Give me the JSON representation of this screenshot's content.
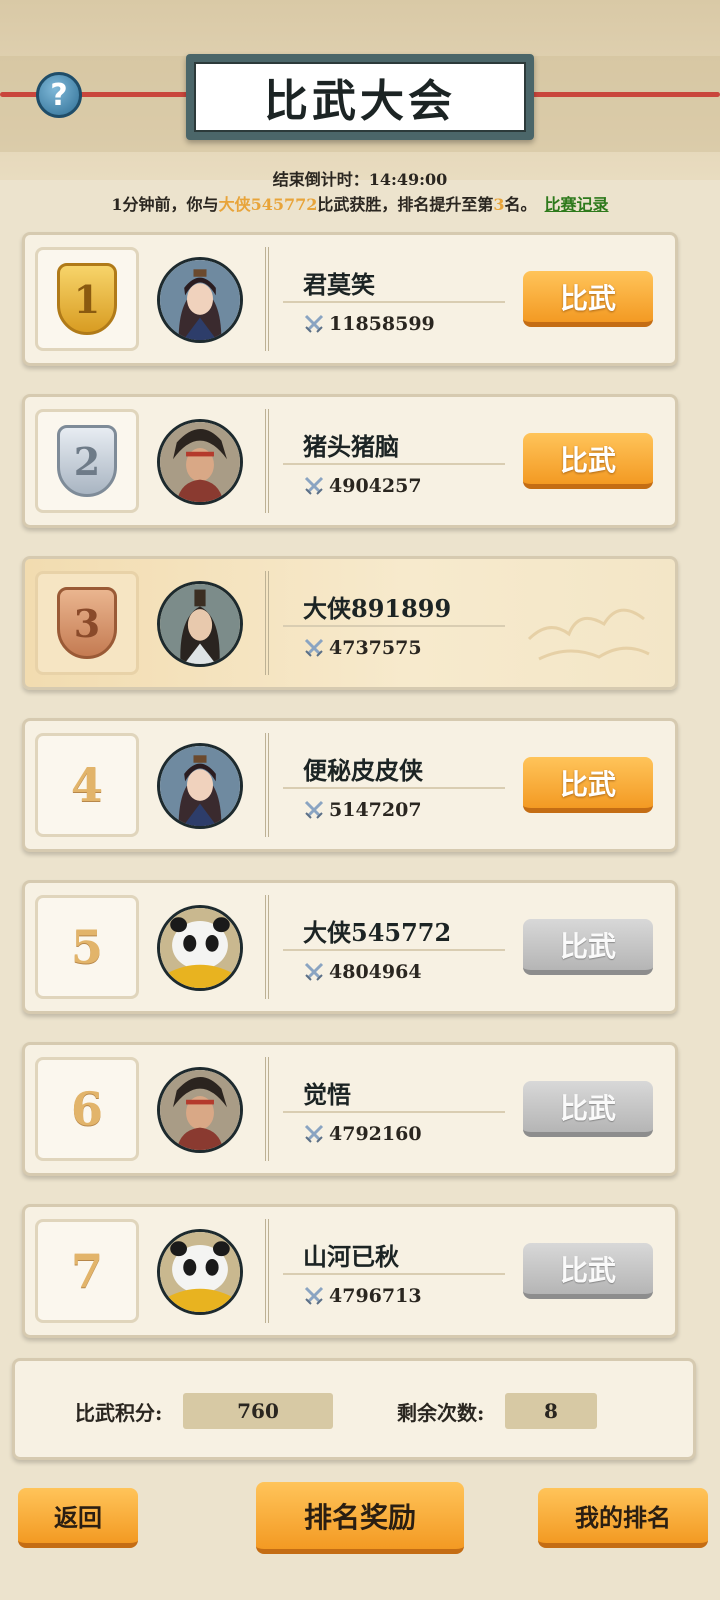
{
  "header": {
    "help_icon": "question-mark-icon",
    "help_label": "?",
    "title": "比武大会",
    "countdown": "结束倒计时：14:49:00",
    "notice": {
      "prefix": "1分钟前，你与",
      "opponent": "大侠545772",
      "middle": "比武获胜，排名提升至第",
      "rank": "3",
      "suffix": "名。",
      "record_link": "比赛记录"
    }
  },
  "ranking": [
    {
      "rank": "1",
      "name": "君莫笑",
      "power": "11858599",
      "button": "比武",
      "enabled": true,
      "avatar": "female-swordsman-avatar"
    },
    {
      "rank": "2",
      "name": "猪头猪脑",
      "power": "4904257",
      "button": "比武",
      "enabled": true,
      "avatar": "male-warrior-avatar"
    },
    {
      "rank": "3",
      "name": "大侠891899",
      "power": "4737575",
      "button": "",
      "enabled": false,
      "avatar": "male-scholar-avatar",
      "is_self": true
    },
    {
      "rank": "4",
      "name": "便秘皮皮侠",
      "power": "5147207",
      "button": "比武",
      "enabled": true,
      "avatar": "female-swordsman-avatar"
    },
    {
      "rank": "5",
      "name": "大侠545772",
      "power": "4804964",
      "button": "比武",
      "enabled": false,
      "avatar": "panda-avatar"
    },
    {
      "rank": "6",
      "name": "觉悟",
      "power": "4792160",
      "button": "比武",
      "enabled": false,
      "avatar": "male-warrior-avatar"
    },
    {
      "rank": "7",
      "name": "山河已秋",
      "power": "4796713",
      "button": "比武",
      "enabled": false,
      "avatar": "panda-avatar"
    }
  ],
  "stats": {
    "points_label": "比武积分:",
    "points_value": "760",
    "remaining_label": "剩余次数:",
    "remaining_value": "8"
  },
  "footer": {
    "back": "返回",
    "rewards": "排名奖励",
    "my_rank": "我的排名"
  },
  "colors": {
    "accent_orange": "#f39a23",
    "highlight": "#e8a43a",
    "link_green": "#2e7a1c",
    "disabled_gray": "#b5b5b5"
  }
}
